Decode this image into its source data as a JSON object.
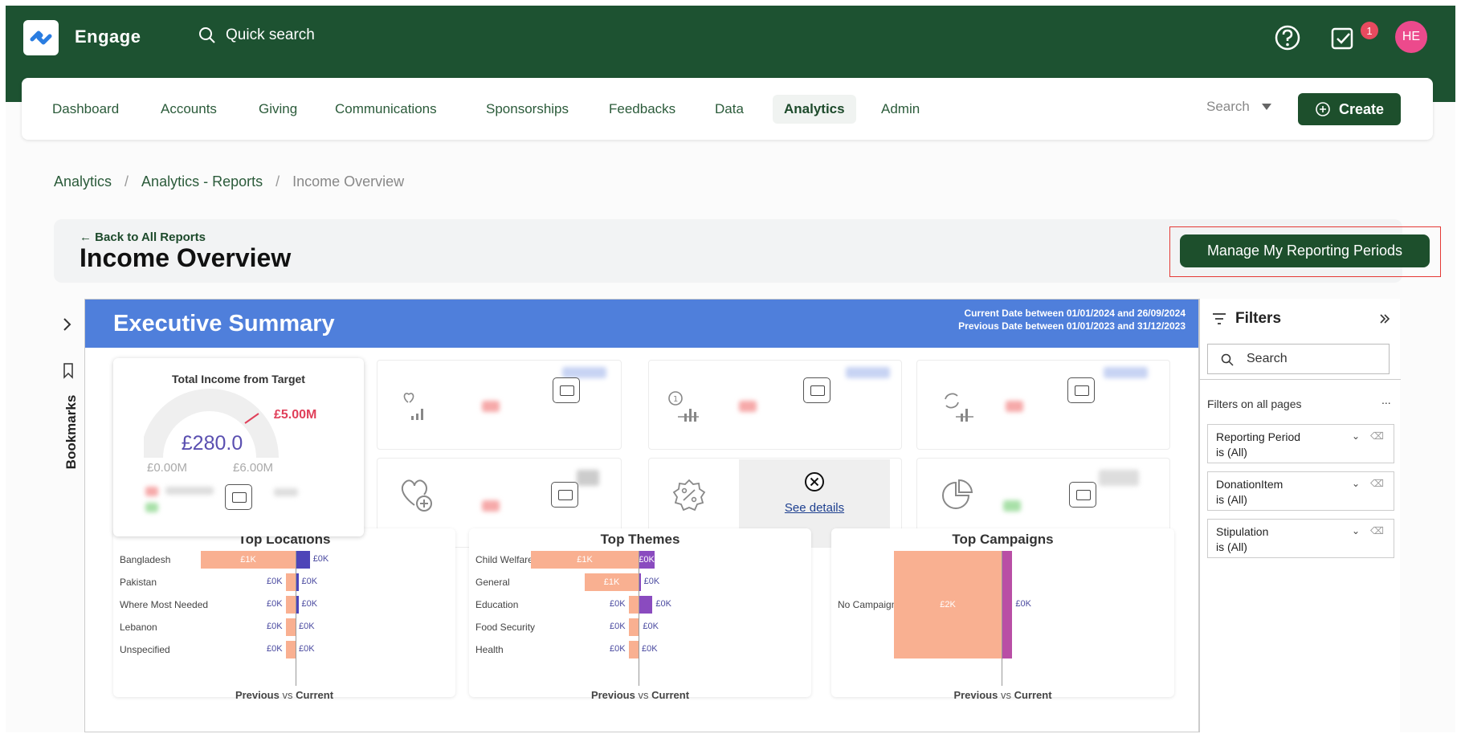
{
  "app": {
    "name": "Engage",
    "quick_search": "Quick search",
    "notification_count": "1",
    "avatar_initials": "HE"
  },
  "nav": {
    "items": [
      "Dashboard",
      "Accounts",
      "Giving",
      "Communications",
      "Sponsorships",
      "Feedbacks",
      "Data",
      "Analytics",
      "Admin"
    ],
    "active": "Analytics",
    "search_label": "Search",
    "create_label": "Create"
  },
  "breadcrumb": {
    "items": [
      "Analytics",
      "Analytics - Reports",
      "Income Overview"
    ],
    "separator": "/"
  },
  "header": {
    "back_label": "Back to All Reports",
    "title": "Income Overview",
    "manage_button": "Manage My Reporting Periods"
  },
  "report": {
    "title": "Executive Summary",
    "current_date": "Current Date between 01/01/2024 and 26/09/2024",
    "previous_date": "Previous Date between 01/01/2023 and 31/12/2023",
    "bookmarks_label": "Bookmarks",
    "gauge": {
      "title": "Total Income from Target",
      "value": "£280.0",
      "target": "£5.00M",
      "min": "£0.00M",
      "max": "£6.00M",
      "fill_fraction": 5e-05
    },
    "see_details": "See details",
    "legend": {
      "previous": "Previous",
      "vs": "vs",
      "current": "Current"
    }
  },
  "colors": {
    "previous": "#f9b091",
    "current_locations": "#4e45b8",
    "current_themes": "#8a4bbf",
    "current_campaigns": "#b94ea5",
    "brand": "#1d5231",
    "banner": "#4f7fdb"
  },
  "chart_data": [
    {
      "type": "bar",
      "title": "Top Locations",
      "categories": [
        "Bangladesh",
        "Pakistan",
        "Where Most Needed",
        "Lebanon",
        "Unspecified"
      ],
      "series": [
        {
          "name": "Previous",
          "values": [
            1,
            0,
            0,
            0,
            0
          ],
          "labels": [
            "£1K",
            "£0K",
            "£0K",
            "£0K",
            "£0K"
          ]
        },
        {
          "name": "Current",
          "values": [
            0.15,
            0.03,
            0.03,
            0,
            0
          ],
          "labels": [
            "£0K",
            "£0K",
            "£0K",
            "£0K",
            "£0K"
          ]
        }
      ]
    },
    {
      "type": "bar",
      "title": "Top Themes",
      "categories": [
        "Child Welfare",
        "General",
        "Education",
        "Food Security",
        "Health"
      ],
      "series": [
        {
          "name": "Previous",
          "values": [
            1,
            0.5,
            0.07,
            0.03,
            0.02
          ],
          "labels": [
            "£1K",
            "£1K",
            "£0K",
            "£0K",
            "£0K"
          ]
        },
        {
          "name": "Current",
          "values": [
            0.15,
            0.02,
            0.13,
            0.01,
            0
          ],
          "labels": [
            "£0K",
            "£0K",
            "£0K",
            "£0K",
            "£0K"
          ]
        }
      ]
    },
    {
      "type": "bar",
      "title": "Top Campaigns",
      "categories": [
        "No Campaign"
      ],
      "series": [
        {
          "name": "Previous",
          "values": [
            2
          ],
          "labels": [
            "£2K"
          ]
        },
        {
          "name": "Current",
          "values": [
            0.2
          ],
          "labels": [
            "£0K"
          ]
        }
      ]
    }
  ],
  "filters": {
    "title": "Filters",
    "search_placeholder": "Search",
    "section": "Filters on all pages",
    "more": "...",
    "items": [
      {
        "name": "Reporting Period",
        "value": "is (All)"
      },
      {
        "name": "DonationItem",
        "value": "is (All)"
      },
      {
        "name": "Stipulation",
        "value": "is (All)"
      }
    ]
  }
}
